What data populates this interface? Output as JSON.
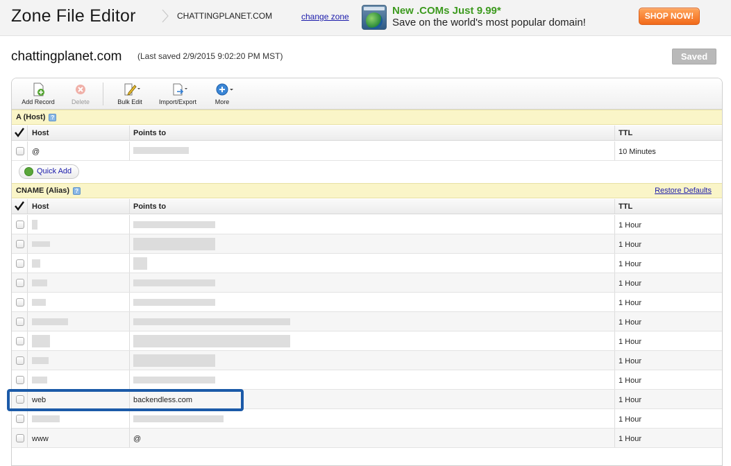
{
  "header": {
    "app_title": "Zone File Editor",
    "domain": "CHATTINGPLANET.COM",
    "change_zone": "change zone",
    "promo_headline": "New .COMs Just 9.99*",
    "promo_sub": "Save on the world's most popular domain!",
    "shop_now": "SHOP NOW!"
  },
  "page": {
    "zone_title": "chattingplanet.com",
    "last_saved": "(Last saved 2/9/2015 9:02:20 PM MST)",
    "saved_button": "Saved"
  },
  "toolbar": {
    "add_record": "Add Record",
    "delete": "Delete",
    "bulk_edit": "Bulk Edit",
    "import_export": "Import/Export",
    "more": "More"
  },
  "a_section": {
    "title": "A (Host)",
    "col_host": "Host",
    "col_points": "Points to",
    "col_ttl": "TTL",
    "rows": [
      {
        "host": "@",
        "points": "",
        "ttl": "10 Minutes"
      }
    ],
    "quick_add": "Quick Add"
  },
  "cname_section": {
    "title": "CNAME (Alias)",
    "restore_defaults": "Restore Defaults",
    "col_host": "Host",
    "col_points": "Points to",
    "col_ttl": "TTL",
    "rows": [
      {
        "host": "",
        "points": "",
        "ttl": "1 Hour"
      },
      {
        "host": "",
        "points": "",
        "ttl": "1 Hour"
      },
      {
        "host": "",
        "points": "",
        "ttl": "1 Hour"
      },
      {
        "host": "",
        "points": "",
        "ttl": "1 Hour"
      },
      {
        "host": "",
        "points": "",
        "ttl": "1 Hour"
      },
      {
        "host": "",
        "points": "",
        "ttl": "1 Hour"
      },
      {
        "host": "",
        "points": "",
        "ttl": "1 Hour"
      },
      {
        "host": "",
        "points": "",
        "ttl": "1 Hour"
      },
      {
        "host": "",
        "points": "",
        "ttl": "1 Hour"
      },
      {
        "host": "web",
        "points": "backendless.com",
        "ttl": "1 Hour"
      },
      {
        "host": "",
        "points": "",
        "ttl": "1 Hour"
      },
      {
        "host": "www",
        "points": "@",
        "ttl": "1 Hour"
      }
    ]
  },
  "colors": {
    "section_header_bg": "#faf5c8",
    "link": "#1a1aaa",
    "highlight": "#1b5aa8",
    "shop_now": "#f26a1a",
    "promo_green": "#3d9a1f"
  }
}
